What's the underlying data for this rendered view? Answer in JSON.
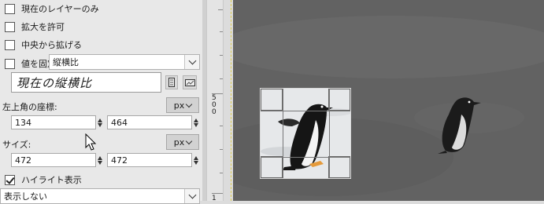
{
  "options": {
    "current_layer_only": {
      "label": "現在のレイヤーのみ",
      "checked": false
    },
    "allow_growing": {
      "label": "拡大を許可",
      "checked": false
    },
    "expand_from_center": {
      "label": "中央から拡げる",
      "checked": false
    },
    "fixed": {
      "label": "値を固定",
      "checked": false,
      "mode_value": "縦横比"
    },
    "ratio_value": "現在の縦横比",
    "highlight": {
      "label": "ハイライト表示",
      "checked": true
    },
    "guides_value": "表示しない"
  },
  "position": {
    "label": "左上角の座標:",
    "unit": "px",
    "x": "134",
    "y": "464"
  },
  "size": {
    "label": "サイズ:",
    "unit": "px",
    "w": "472",
    "h": "472"
  },
  "ruler": {
    "labels": [
      "5",
      "0",
      "0"
    ],
    "bottom_label": "1"
  },
  "colors": {
    "panel_bg": "#e8e8e8",
    "canvas_bg": "#5f5f5f",
    "guide": "#d9c94a"
  }
}
